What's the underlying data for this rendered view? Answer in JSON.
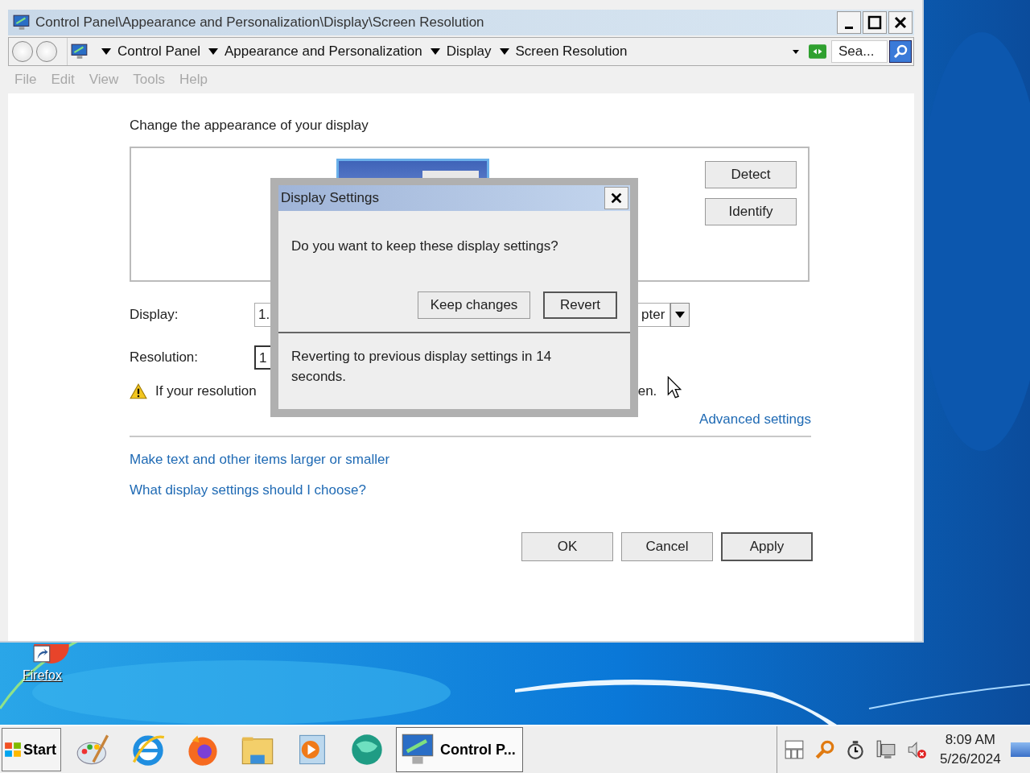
{
  "window": {
    "title": "Control Panel\\Appearance and Personalization\\Display\\Screen Resolution",
    "breadcrumbs": [
      "Control Panel",
      "Appearance and Personalization",
      "Display",
      "Screen Resolution"
    ],
    "search": {
      "placeholder": "Sea..."
    },
    "menu": [
      "File",
      "Edit",
      "View",
      "Tools",
      "Help"
    ]
  },
  "content": {
    "heading": "Change the appearance of your display",
    "side_buttons": [
      "Detect",
      "Identify"
    ],
    "display": {
      "label": "Display:",
      "value": "1.",
      "dropdown_value": "pter"
    },
    "resolution": {
      "label": "Resolution:",
      "value": "1"
    },
    "warning": {
      "start": "If your resolution",
      "end": "en."
    },
    "advanced_link": "Advanced settings",
    "links": [
      "Make text and other items larger or smaller",
      "What display settings should I choose?"
    ],
    "buttons": [
      "OK",
      "Cancel",
      "Apply"
    ]
  },
  "dialog": {
    "title": "Display Settings",
    "message": "Do you want to keep these display settings?",
    "buttons": [
      {
        "label": "Keep changes",
        "default": false
      },
      {
        "label": "Revert",
        "default": true
      }
    ],
    "countdown": "Reverting to previous display settings in 14 seconds."
  },
  "desktop_icons": [
    {
      "label": "Firefox"
    }
  ],
  "taskbar": {
    "start": "Start",
    "active_task": "Control P...",
    "time": "8:09 AM",
    "date": "5/26/2024"
  }
}
